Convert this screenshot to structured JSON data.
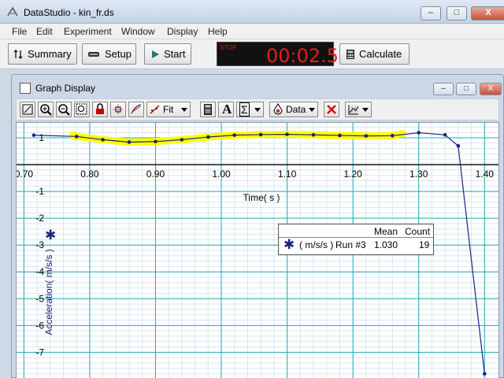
{
  "window": {
    "title": "DataStudio - kin_fr.ds",
    "minimize": "–",
    "maximize": "□",
    "close": "X"
  },
  "menu": [
    "File",
    "Edit",
    "Experiment",
    "Window",
    "Display",
    "Help"
  ],
  "toolbar": {
    "summary": "Summary",
    "setup": "Setup",
    "start": "Start",
    "calculate": "Calculate"
  },
  "timer": {
    "status": "STOP",
    "time": "00:02.5"
  },
  "graph_window": {
    "title": "Graph Display",
    "minimize": "–",
    "maximize": "□",
    "close": "X"
  },
  "graph_toolbar": {
    "fit": "Fit",
    "text": "A",
    "sigma": "Σ",
    "data": "Data"
  },
  "legend": {
    "marker": "✱",
    "header_mean": "Mean",
    "header_count": "Count",
    "unit": "( m/s/s )",
    "run": "Run #3",
    "mean": "1.030",
    "count": "19"
  },
  "chart_data": {
    "type": "line",
    "xlabel": "Time( s )",
    "ylabel": "Acceleration( m/s/s )",
    "x_ticks": [
      "0.70",
      "0.80",
      "0.90",
      "1.00",
      "1.10",
      "1.20",
      "1.30",
      "1.40"
    ],
    "y_ticks": [
      "1",
      "-1",
      "-2",
      "-3",
      "-4",
      "-5",
      "-6",
      "-7"
    ],
    "xlim": [
      0.69,
      1.42
    ],
    "ylim": [
      -7.9,
      1.5
    ],
    "grid": true,
    "series": [
      {
        "name": "( m/s/s ) Run #3",
        "color": "#1a237e",
        "x": [
          0.715,
          0.78,
          0.82,
          0.86,
          0.9,
          0.94,
          0.98,
          1.02,
          1.06,
          1.1,
          1.14,
          1.18,
          1.22,
          1.26,
          1.3,
          1.34,
          1.36,
          1.4
        ],
        "y": [
          1.1,
          1.05,
          0.93,
          0.84,
          0.86,
          0.93,
          1.03,
          1.1,
          1.12,
          1.13,
          1.11,
          1.09,
          1.07,
          1.08,
          1.19,
          1.11,
          0.7,
          -7.8
        ]
      }
    ],
    "highlight": {
      "color": "#ffff00",
      "x": [
        0.775,
        0.78,
        0.82,
        0.86,
        0.9,
        0.94,
        0.98,
        1.02,
        1.06,
        1.1,
        1.14,
        1.18,
        1.22,
        1.26,
        1.275
      ],
      "y": [
        1.1,
        1.05,
        0.93,
        0.84,
        0.86,
        0.93,
        1.03,
        1.1,
        1.12,
        1.13,
        1.11,
        1.09,
        1.07,
        1.08,
        1.15
      ]
    }
  }
}
